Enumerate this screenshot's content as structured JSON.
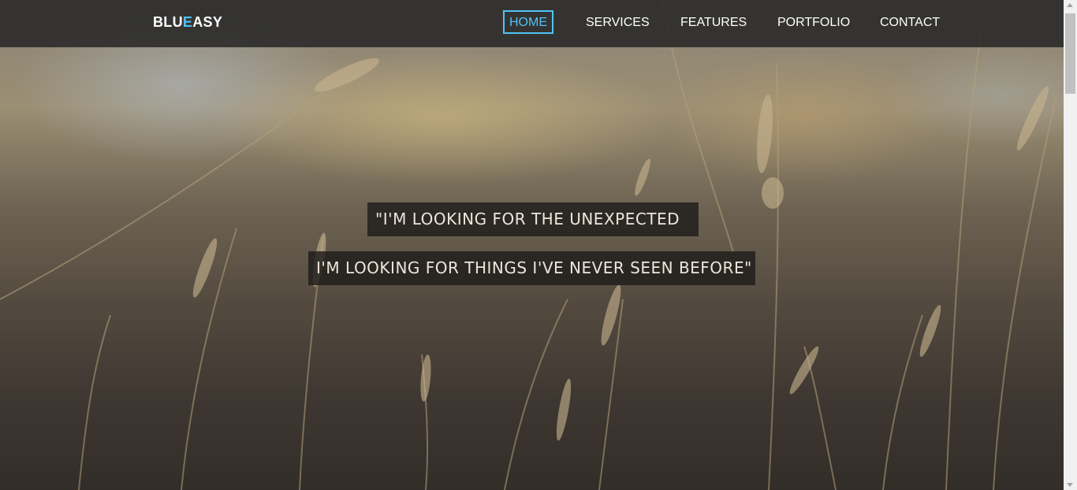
{
  "brand": {
    "part1": "BLU",
    "accent_letter": "E",
    "part2": "ASY"
  },
  "nav": {
    "items": [
      {
        "label": "HOME",
        "active": true
      },
      {
        "label": "SERVICES",
        "active": false
      },
      {
        "label": "FEATURES",
        "active": false
      },
      {
        "label": "PORTFOLIO",
        "active": false
      },
      {
        "label": "CONTACT",
        "active": false
      }
    ]
  },
  "hero": {
    "quote_line1": "\"I'M LOOKING FOR THE UNEXPECTED",
    "quote_line2": "I'M LOOKING FOR THINGS I'VE NEVER SEEN BEFORE\"",
    "background_icon": "wheat-grass-photo"
  },
  "colors": {
    "accent": "#4fc3f7",
    "navbar_bg": "#282828",
    "quote_bg": "#1e1c1a",
    "quote_text": "#ece6dc"
  }
}
